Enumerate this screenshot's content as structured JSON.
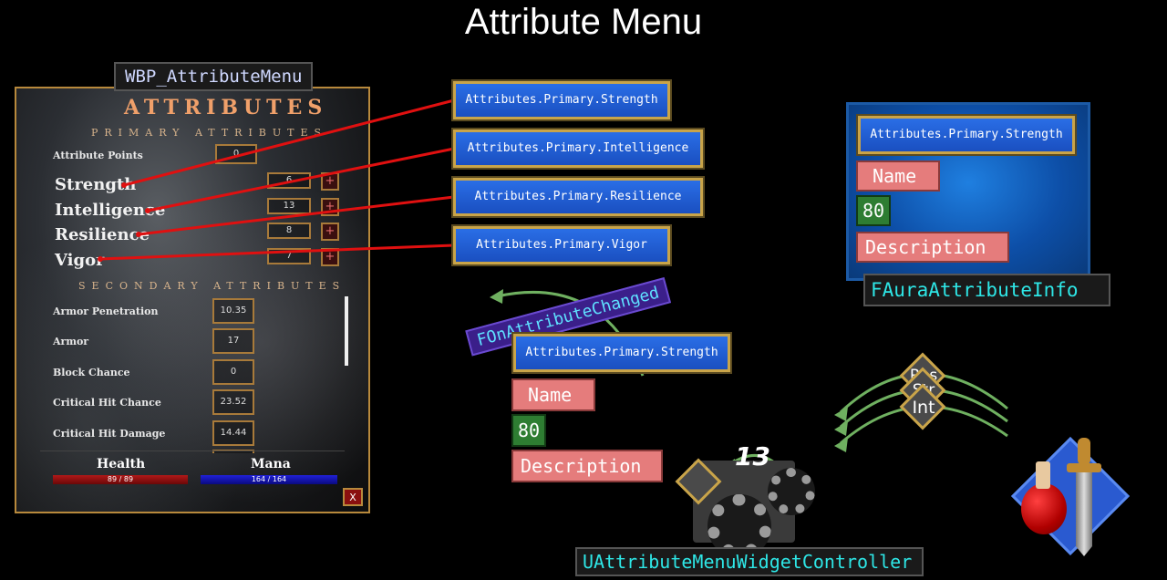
{
  "title": "Attribute Menu",
  "widget_label": "WBP_AttributeMenu",
  "menu": {
    "heading": "ATTRIBUTES",
    "primary_heading": "PRIMARY ATTRIBUTES",
    "attribute_points_label": "Attribute Points",
    "attribute_points_value": "0",
    "primary": [
      {
        "name": "Strength",
        "value": "6"
      },
      {
        "name": "Intelligence",
        "value": "13"
      },
      {
        "name": "Resilience",
        "value": "8"
      },
      {
        "name": "Vigor",
        "value": "7"
      }
    ],
    "plus_label": "+",
    "secondary_heading": "SECONDARY ATTRIBUTES",
    "secondary": [
      {
        "name": "Armor Penetration",
        "value": "10.35"
      },
      {
        "name": "Armor",
        "value": "17"
      },
      {
        "name": "Block Chance",
        "value": "0"
      },
      {
        "name": "Critical Hit Chance",
        "value": "23.52"
      },
      {
        "name": "Critical Hit Damage",
        "value": "14.44"
      }
    ],
    "health_label": "Health",
    "health_value": "89 / 89",
    "mana_label": "Mana",
    "mana_value": "164 / 164",
    "close_label": "X"
  },
  "tags": [
    "Attributes.Primary.Strength",
    "Attributes.Primary.Intelligence",
    "Attributes.Primary.Resilience",
    "Attributes.Primary.Vigor"
  ],
  "delegate_label": "FOnAttributeChanged",
  "center_info": {
    "tag": "Attributes.Primary.Strength",
    "name": "Name",
    "value": "80",
    "description": "Description"
  },
  "info_panel": {
    "tag": "Attributes.Primary.Strength",
    "name": "Name",
    "value": "80",
    "description": "Description",
    "label": "FAuraAttributeInfo"
  },
  "controller_label": "UAttributeMenuWidgetController",
  "controller_number": "13",
  "stacked_tags": [
    "Res",
    "Str",
    "Int"
  ],
  "colors": {
    "tag_blue": "#2a6ee6",
    "tag_border": "#c9a449",
    "connector_red": "#e01010",
    "arrow_green": "#6fb060",
    "name_pink": "#e57c7c",
    "value_green": "#2e7d32",
    "label_cyan": "#2ee6e6"
  }
}
